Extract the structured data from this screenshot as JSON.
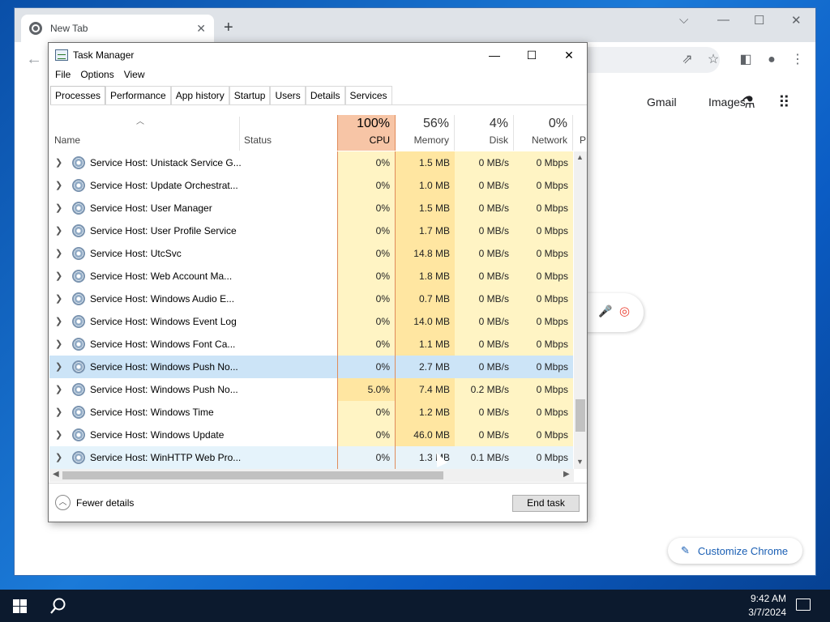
{
  "chrome": {
    "tab_title": "New Tab",
    "links": [
      "Gmail",
      "Images"
    ],
    "customize_label": "Customize Chrome"
  },
  "taskmanager": {
    "title": "Task Manager",
    "menu": [
      "File",
      "Options",
      "View"
    ],
    "tabs": [
      "Processes",
      "Performance",
      "App history",
      "Startup",
      "Users",
      "Details",
      "Services"
    ],
    "active_tab": "Processes",
    "columns": {
      "name": "Name",
      "status": "Status",
      "cpu": {
        "pct": "100%",
        "label": "CPU"
      },
      "memory": {
        "pct": "56%",
        "label": "Memory"
      },
      "disk": {
        "pct": "4%",
        "label": "Disk"
      },
      "network": {
        "pct": "0%",
        "label": "Network"
      },
      "next_truncated": "P"
    },
    "rows": [
      {
        "name": "Service Host: Unistack Service G...",
        "cpu": "0%",
        "memory": "1.5 MB",
        "disk": "0 MB/s",
        "network": "0 Mbps"
      },
      {
        "name": "Service Host: Update Orchestrat...",
        "cpu": "0%",
        "memory": "1.0 MB",
        "disk": "0 MB/s",
        "network": "0 Mbps"
      },
      {
        "name": "Service Host: User Manager",
        "cpu": "0%",
        "memory": "1.5 MB",
        "disk": "0 MB/s",
        "network": "0 Mbps"
      },
      {
        "name": "Service Host: User Profile Service",
        "cpu": "0%",
        "memory": "1.7 MB",
        "disk": "0 MB/s",
        "network": "0 Mbps"
      },
      {
        "name": "Service Host: UtcSvc",
        "cpu": "0%",
        "memory": "14.8 MB",
        "disk": "0 MB/s",
        "network": "0 Mbps"
      },
      {
        "name": "Service Host: Web Account Ma...",
        "cpu": "0%",
        "memory": "1.8 MB",
        "disk": "0 MB/s",
        "network": "0 Mbps"
      },
      {
        "name": "Service Host: Windows Audio E...",
        "cpu": "0%",
        "memory": "0.7 MB",
        "disk": "0 MB/s",
        "network": "0 Mbps"
      },
      {
        "name": "Service Host: Windows Event Log",
        "cpu": "0%",
        "memory": "14.0 MB",
        "disk": "0 MB/s",
        "network": "0 Mbps"
      },
      {
        "name": "Service Host: Windows Font Ca...",
        "cpu": "0%",
        "memory": "1.1 MB",
        "disk": "0 MB/s",
        "network": "0 Mbps"
      },
      {
        "name": "Service Host: Windows Push No...",
        "cpu": "0%",
        "memory": "2.7 MB",
        "disk": "0 MB/s",
        "network": "0 Mbps",
        "state": "selected"
      },
      {
        "name": "Service Host: Windows Push No...",
        "cpu": "5.0%",
        "memory": "7.4 MB",
        "disk": "0.2 MB/s",
        "network": "0 Mbps",
        "state": "hot"
      },
      {
        "name": "Service Host: Windows Time",
        "cpu": "0%",
        "memory": "1.2 MB",
        "disk": "0 MB/s",
        "network": "0 Mbps"
      },
      {
        "name": "Service Host: Windows Update",
        "cpu": "0%",
        "memory": "46.0 MB",
        "disk": "0 MB/s",
        "network": "0 Mbps"
      },
      {
        "name": "Service Host: WinHTTP Web Pro...",
        "cpu": "0%",
        "memory": "1.3 MB",
        "disk": "0.1 MB/s",
        "network": "0 Mbps",
        "state": "hover"
      }
    ],
    "fewer_details": "Fewer details",
    "end_task": "End task"
  },
  "taskbar": {
    "time": "9:42 AM",
    "date": "3/7/2024"
  }
}
